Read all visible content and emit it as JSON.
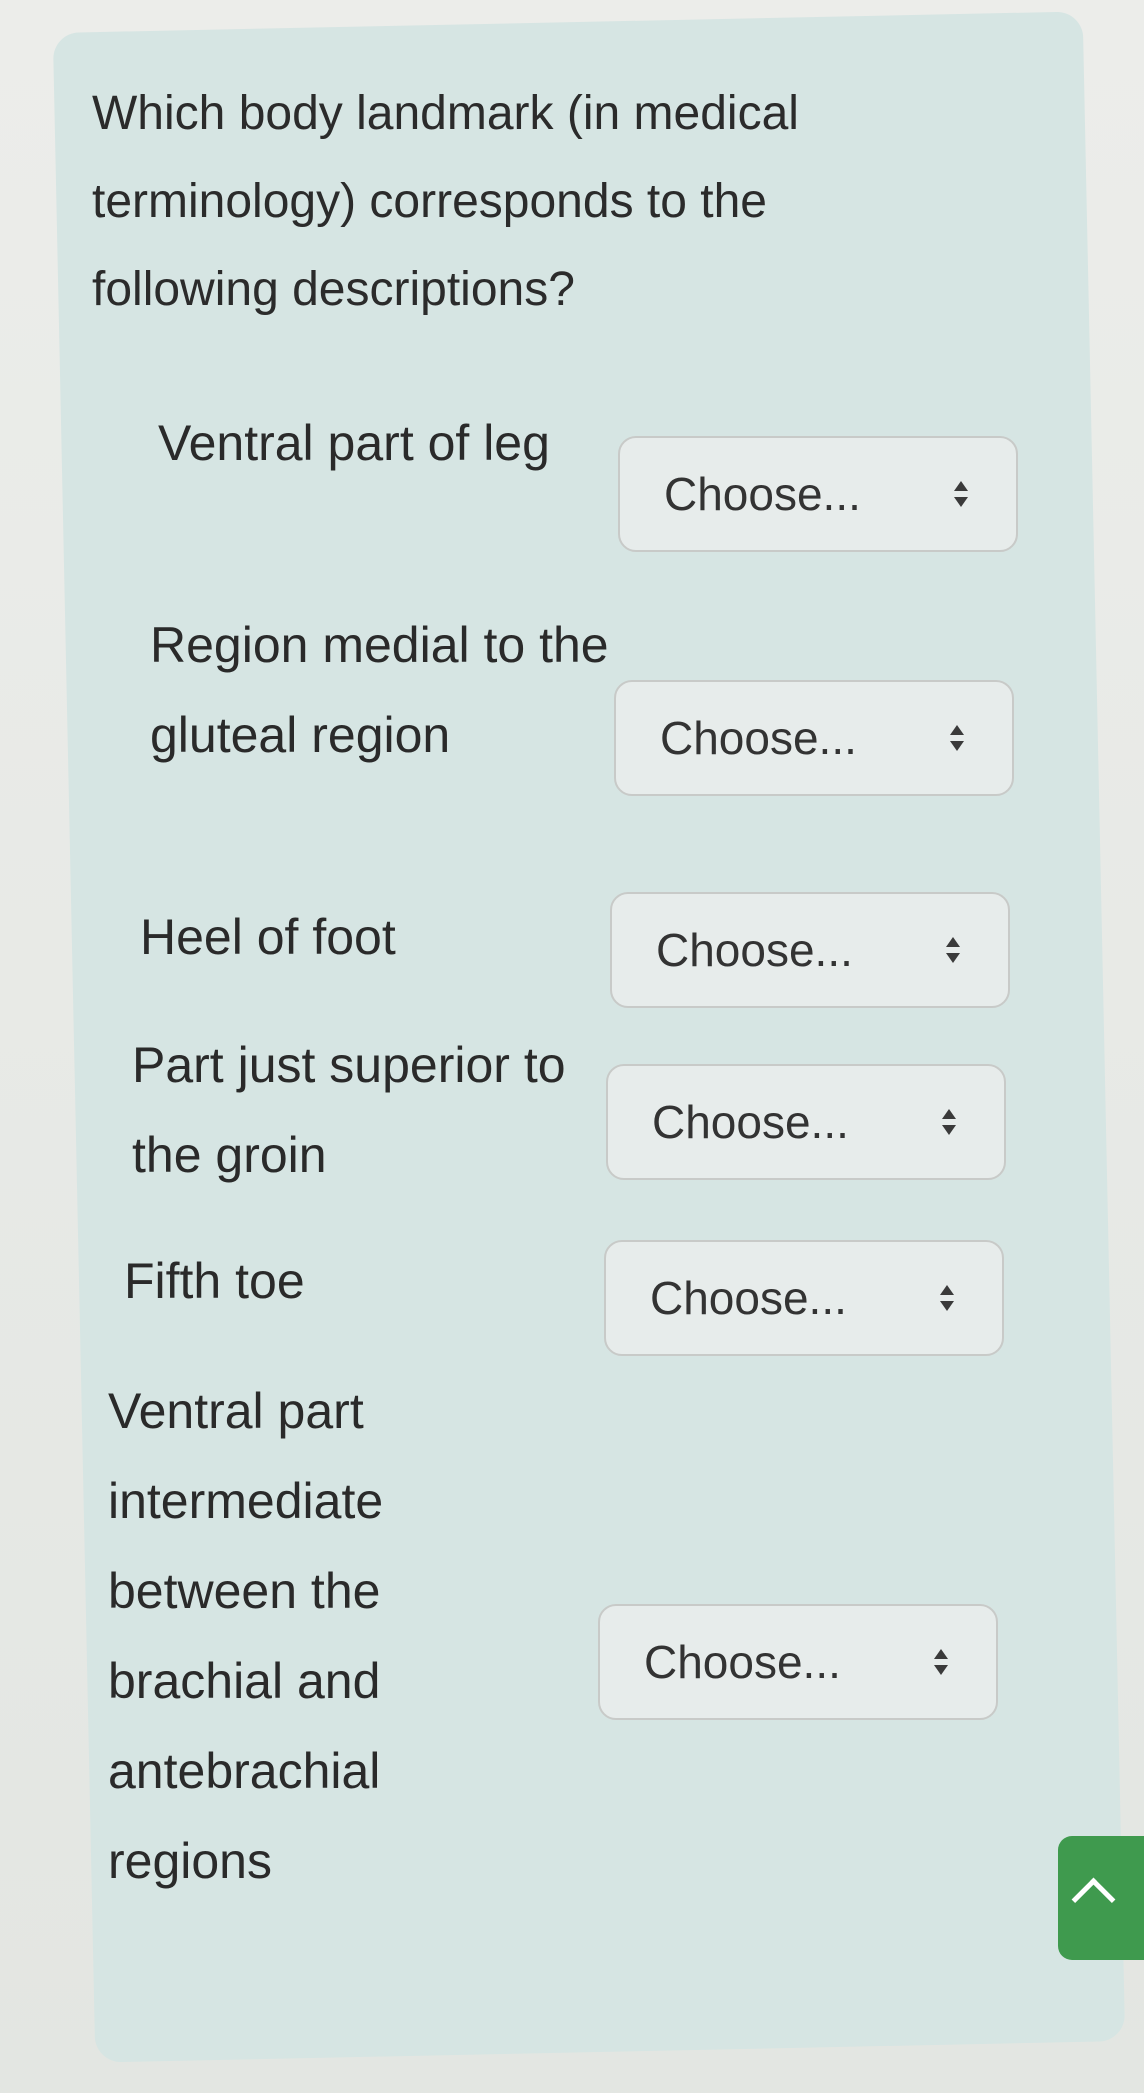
{
  "question": "Which body landmark (in medical terminology) corresponds to the following descriptions?",
  "rows": [
    {
      "description": "Ventral part of leg",
      "select_label": "Choose..."
    },
    {
      "description": "Region medial to the gluteal region",
      "select_label": "Choose..."
    },
    {
      "description": "Heel of foot",
      "select_label": "Choose..."
    },
    {
      "description": "Part just superior to the groin",
      "select_label": "Choose..."
    },
    {
      "description": "Fifth toe",
      "select_label": "Choose..."
    },
    {
      "description": "Ventral part intermediate between the brachial and antebrachial regions",
      "select_label": "Choose..."
    }
  ],
  "colors": {
    "card": "#d6e5e3",
    "scroll_top_button": "#3f9a4e"
  },
  "icons": {
    "select_indicator": "updown-icon",
    "scroll_top": "chevron-up-icon"
  }
}
